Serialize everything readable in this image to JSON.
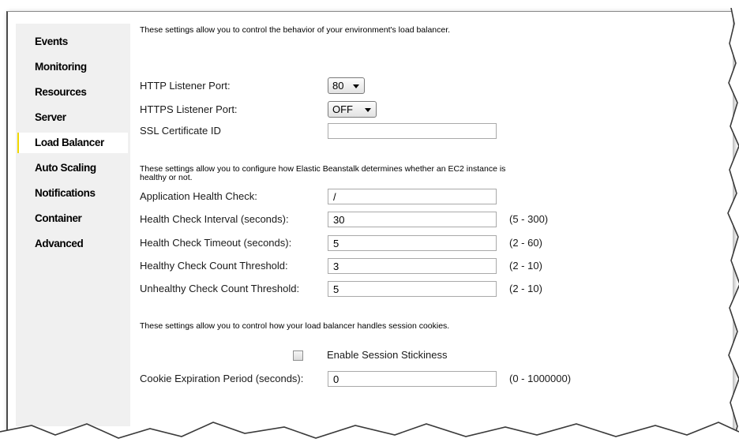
{
  "sidebar": {
    "items": [
      {
        "label": "Events"
      },
      {
        "label": "Monitoring"
      },
      {
        "label": "Resources"
      },
      {
        "label": "Server"
      },
      {
        "label": "Load Balancer",
        "active": true
      },
      {
        "label": "Auto Scaling"
      },
      {
        "label": "Notifications"
      },
      {
        "label": "Container"
      },
      {
        "label": "Advanced"
      }
    ],
    "active_color": "#f0d800"
  },
  "listener": {
    "description": "These settings allow you to control the behavior of your environment's load balancer.",
    "http_port_label": "HTTP Listener Port:",
    "http_port_value": "80",
    "https_port_label": "HTTPS Listener Port:",
    "https_port_value": "OFF",
    "ssl_cert_label": "SSL Certificate ID",
    "ssl_cert_value": ""
  },
  "health": {
    "description": "These settings allow you to configure how Elastic Beanstalk determines whether an EC2 instance is healthy or not.",
    "app_check_label": "Application Health Check:",
    "app_check_value": "/",
    "interval_label": "Health Check Interval (seconds):",
    "interval_value": "30",
    "interval_range": "(5 - 300)",
    "timeout_label": "Health Check Timeout (seconds):",
    "timeout_value": "5",
    "timeout_range": "(2 - 60)",
    "healthy_label": "Healthy Check Count Threshold:",
    "healthy_value": "3",
    "healthy_range": "(2 - 10)",
    "unhealthy_label": "Unhealthy Check Count Threshold:",
    "unhealthy_value": "5",
    "unhealthy_range": "(2 - 10)"
  },
  "session": {
    "description": "These settings allow you to control how your load balancer handles session cookies.",
    "stickiness_label": "Enable Session Stickiness",
    "stickiness_checked": false,
    "cookie_label": "Cookie Expiration Period (seconds):",
    "cookie_value": "0",
    "cookie_range": "(0 - 1000000)"
  }
}
